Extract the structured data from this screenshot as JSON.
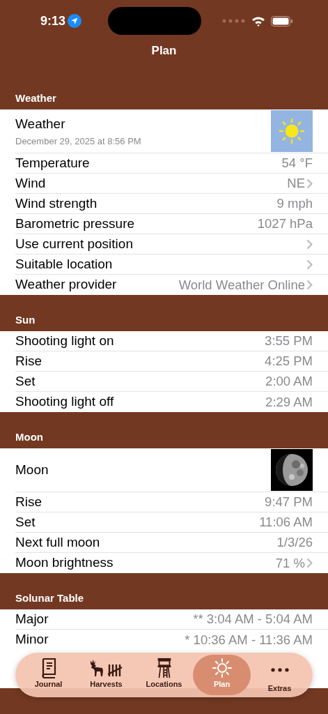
{
  "status_bar": {
    "time": "9:13"
  },
  "nav": {
    "title": "Plan"
  },
  "sections": [
    {
      "header": "Weather",
      "rows": [
        {
          "title": "Weather",
          "subtitle": "December 29, 2025 at 8:56 PM"
        },
        {
          "kind": "value",
          "label": "Temperature",
          "value": "54 °F",
          "chevron": false
        },
        {
          "kind": "value",
          "label": "Wind",
          "value": "NE",
          "chevron": true
        },
        {
          "kind": "value",
          "label": "Wind strength",
          "value": "9 mph",
          "chevron": false
        },
        {
          "kind": "value",
          "label": "Barometric pressure",
          "value": "1027 hPa",
          "chevron": false
        },
        {
          "kind": "value",
          "label": "Use current position",
          "chevron": true
        },
        {
          "kind": "value",
          "label": "Suitable location",
          "chevron": true
        },
        {
          "kind": "value",
          "label": "Weather provider",
          "value": "World Weather Online",
          "chevron": true
        }
      ]
    },
    {
      "header": "Sun",
      "rows": [
        {
          "kind": "value",
          "label": "Shooting light on",
          "value": "3:55 PM",
          "chevron": false
        },
        {
          "kind": "value",
          "label": "Rise",
          "value": "4:25 PM",
          "chevron": false
        },
        {
          "kind": "value",
          "label": "Set",
          "value": "2:00 AM",
          "chevron": false
        },
        {
          "kind": "value",
          "label": "Shooting light off",
          "value": "2:29 AM",
          "chevron": false
        }
      ]
    },
    {
      "header": "Moon",
      "rows": [
        {
          "title": "Moon"
        },
        {
          "kind": "value",
          "label": "Rise",
          "value": "9:47 PM",
          "chevron": false
        },
        {
          "kind": "value",
          "label": "Set",
          "value": "11:06 AM",
          "chevron": false
        },
        {
          "kind": "value",
          "label": "Next full moon",
          "value": "1/3/26",
          "chevron": false
        },
        {
          "kind": "value",
          "label": "Moon brightness",
          "value": "71 %",
          "chevron": true
        }
      ]
    },
    {
      "header": "Solunar Table",
      "rows": [
        {
          "kind": "value",
          "label": "Major",
          "value": "** 3:04 AM - 5:04 AM",
          "chevron": false
        },
        {
          "kind": "value",
          "label": "Minor",
          "value": "* 10:36 AM - 11:36 AM",
          "chevron": false
        }
      ]
    }
  ],
  "tab_bar": [
    {
      "label": "Journal",
      "selected": false
    },
    {
      "label": "Harvests",
      "selected": false
    },
    {
      "label": "Locations",
      "selected": false
    },
    {
      "label": "Plan",
      "selected": true
    },
    {
      "label": "Extras",
      "selected": false
    }
  ]
}
